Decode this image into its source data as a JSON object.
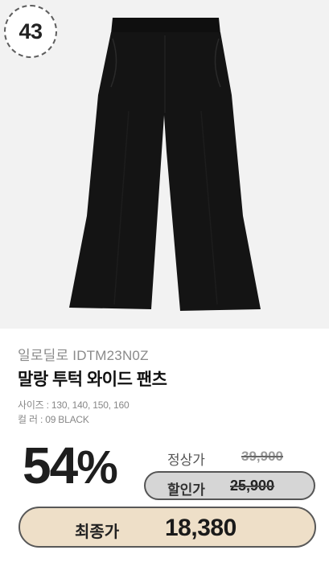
{
  "rank": {
    "number": "43"
  },
  "product": {
    "brand": "일로딜로 IDTM23N0Z",
    "title": "말랑 투턱 와이드 팬츠",
    "size_line": "사이즈 : 130, 140, 150, 160",
    "color_line": "컬    러 : 09 BLACK",
    "image_icon": "black-wide-pants"
  },
  "pricing": {
    "discount_number": "54",
    "discount_symbol": "%",
    "regular_label": "정상가",
    "regular_price": "39,900",
    "sale_label": "할인가",
    "sale_price": "25,900",
    "final_label": "최종가",
    "final_price": "18,380"
  },
  "colors": {
    "photo_bg": "#f2f2f2",
    "final_pill_bg": "#eedfc8",
    "sale_pill_bg": "#d6d6d6",
    "pants": "#131313"
  }
}
